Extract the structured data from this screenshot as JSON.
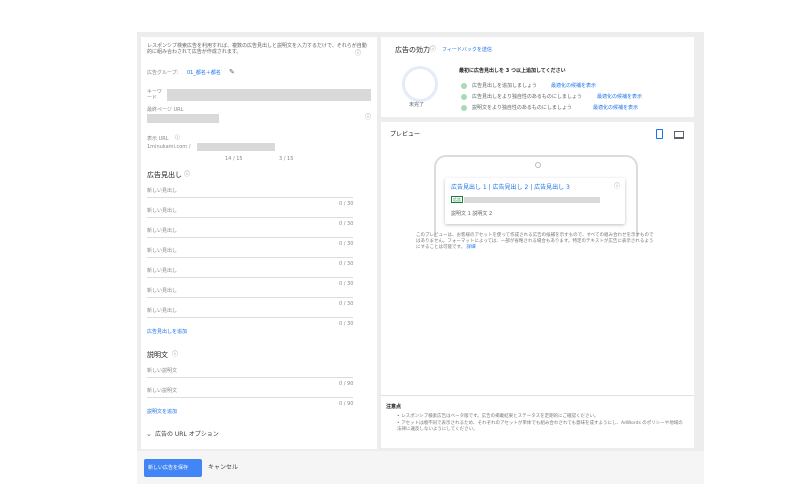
{
  "left": {
    "intro": "レスポンシブ検索広告を利用すれば、複数の広告見出しと説明文を入力するだけで、それらが自動的に組み合わされて広告が作成されます。",
    "ad_group_label": "広告グループ:",
    "ad_group_value": "01_都名＋都名",
    "keyword_label": "キーワード",
    "final_url_label": "最終ページ URL",
    "display_url_label": "表示 URL",
    "display_url_base": "1minukami.com /",
    "path1_count": "14 / 15",
    "path2_count": "3 / 15",
    "headlines_title": "広告見出し",
    "headlines": [
      {
        "placeholder": "新しい見出し",
        "count": "0 / 30"
      },
      {
        "placeholder": "新しい見出し",
        "count": "0 / 30"
      },
      {
        "placeholder": "新しい見出し",
        "count": "0 / 30"
      },
      {
        "placeholder": "新しい見出し",
        "count": "0 / 30"
      },
      {
        "placeholder": "新しい見出し",
        "count": "0 / 30"
      },
      {
        "placeholder": "新しい見出し",
        "count": "0 / 30"
      },
      {
        "placeholder": "新しい見出し",
        "count": "0 / 30"
      }
    ],
    "add_headline": "広告見出しを追加",
    "descriptions_title": "説明文",
    "descriptions": [
      {
        "placeholder": "新しい説明文",
        "count": "0 / 90"
      },
      {
        "placeholder": "新しい説明文",
        "count": "0 / 90"
      }
    ],
    "add_description": "説明文を追加",
    "url_options": "広告の URL オプション"
  },
  "strength": {
    "title": "広告の効力",
    "feedback": "フィードバックを送信",
    "status": "未完了",
    "heading": "最初に広告見出しを 3 つ以上追加してください",
    "items": [
      {
        "text": "広告見出しを追加しましょう",
        "link": "最適化の候補を表示"
      },
      {
        "text": "広告見出しをより独自性のあるものにしましょう",
        "link": "最適化の候補を表示"
      },
      {
        "text": "説明文をより独自性のあるものにしましょう",
        "link": "最適化の候補を表示"
      }
    ]
  },
  "preview": {
    "title": "プレビュー",
    "headline": "広告見出し 1 | 広告見出し 2 | 広告見出し 3",
    "ad_badge": "広告",
    "description": "説明文 1 説明文 2",
    "note": "このプレビューは、お客様のアセットを使って作成される広告の候補を示すもので、すべての組み合わせを示すものではありません。フォーマットによっては、一部が省略される場合もあります。特定のテキストが広告に表示されるようにすることは可能です。",
    "note_link": "詳細"
  },
  "notes": {
    "title": "注意点",
    "items": [
      "レスポンシブ検索広告はベータ版です。広告の掲載結果とステータスを定期的にご確認ください。",
      "アセットは順不同で表示されるため、それぞれのアセットが単体でも組み合わされても意味を成すようにし、AdWords のポリシーや地域の法律に違反しないようにしてください。"
    ]
  },
  "actions": {
    "save": "新しい広告を保存",
    "cancel": "キャンセル"
  }
}
